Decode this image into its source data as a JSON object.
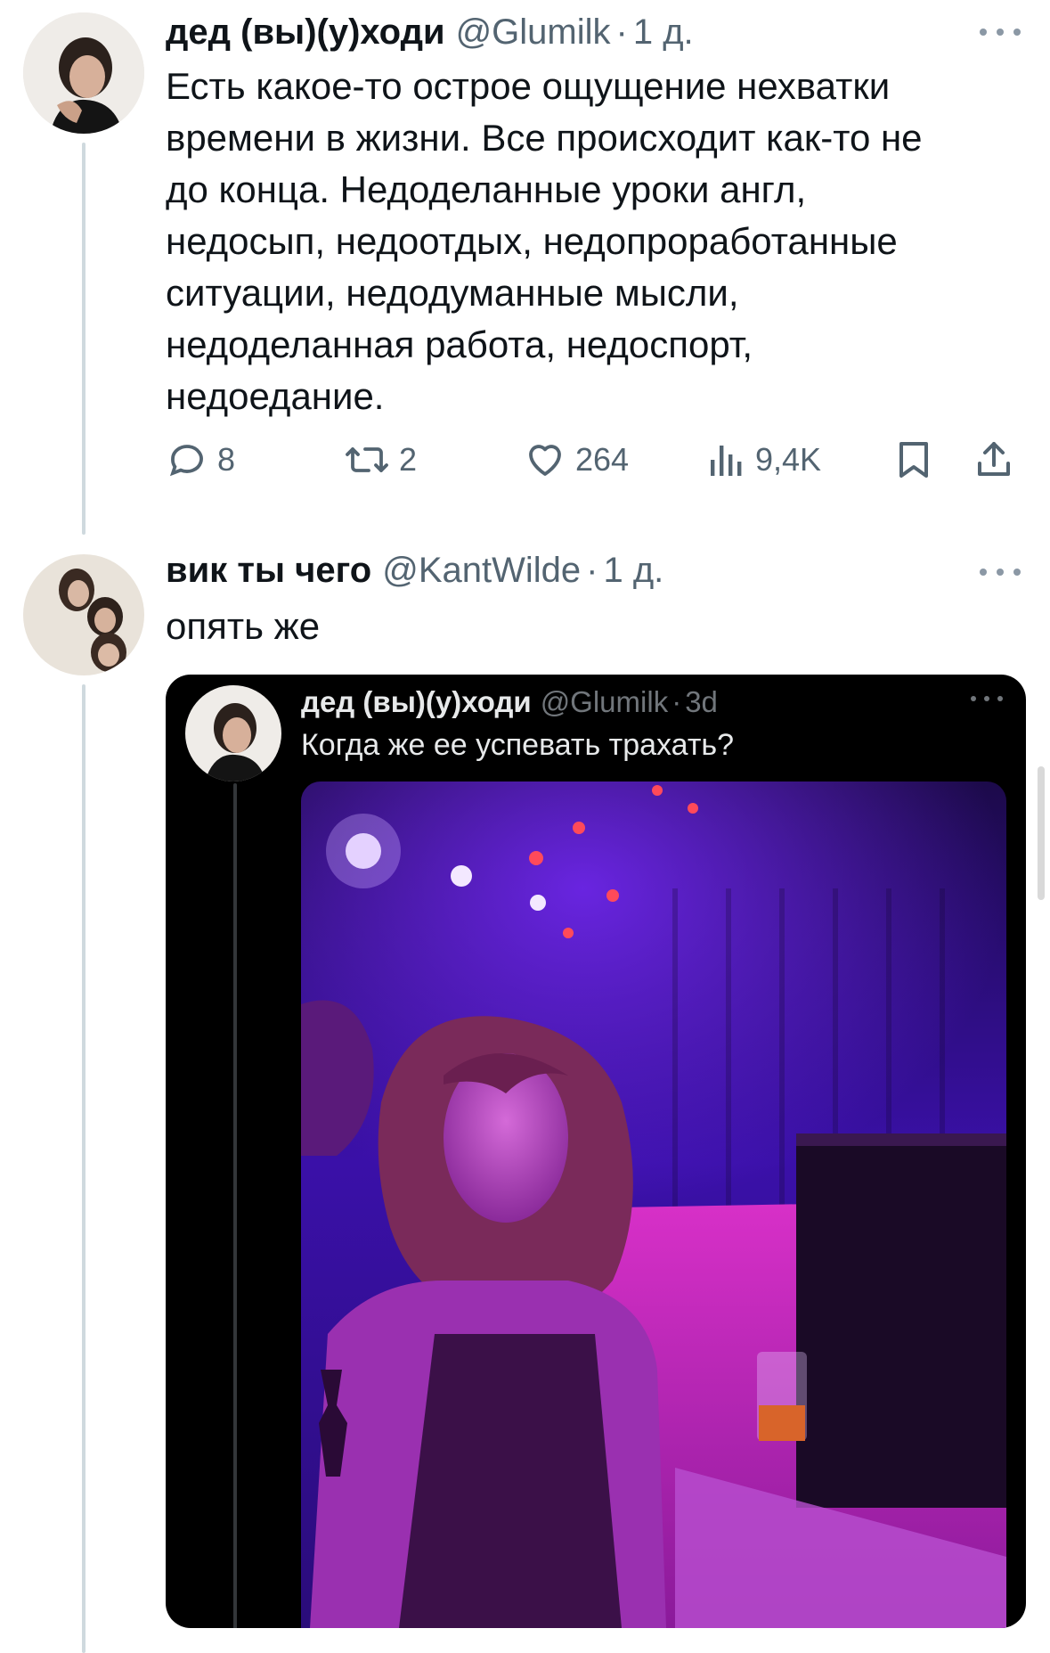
{
  "tweet1": {
    "display_name": "дед (вы)(у)ходи",
    "handle": "@Glumilk",
    "separator": "·",
    "time": "1 д.",
    "text_lines": [
      "Есть какое-то острое ощущение нехватки",
      "времени в жизни. Все происходит как-то не",
      "до конца. Недоделанные уроки англ,",
      "недосып, недоотдых, недопроработанные",
      "ситуации, недодуманные мысли,",
      "недоделанная работа, недоспорт,",
      "недоедание."
    ],
    "replies": "8",
    "retweets": "2",
    "likes": "264",
    "views": "9,4K"
  },
  "tweet2": {
    "display_name": "вик ты чего",
    "handle": "@KantWilde",
    "separator": "·",
    "time": "1 д.",
    "text": "опять же"
  },
  "quoted": {
    "display_name": "дед (вы)(у)ходи",
    "handle": "@Glumilk",
    "separator": "·",
    "time": "3d",
    "text": "Когда же ее успевать трахать?"
  },
  "colors": {
    "text_primary": "#0f1419",
    "text_secondary": "#536471",
    "thread_line": "#cfd9de",
    "quote_bg": "#000000",
    "photo_purple": "#5a1fd1",
    "photo_magenta": "#c020b8"
  },
  "icons": {
    "reply": "reply-icon",
    "retweet": "retweet-icon",
    "like": "heart-icon",
    "views": "views-icon",
    "bookmark": "bookmark-icon",
    "share": "share-icon",
    "more": "more-icon"
  }
}
